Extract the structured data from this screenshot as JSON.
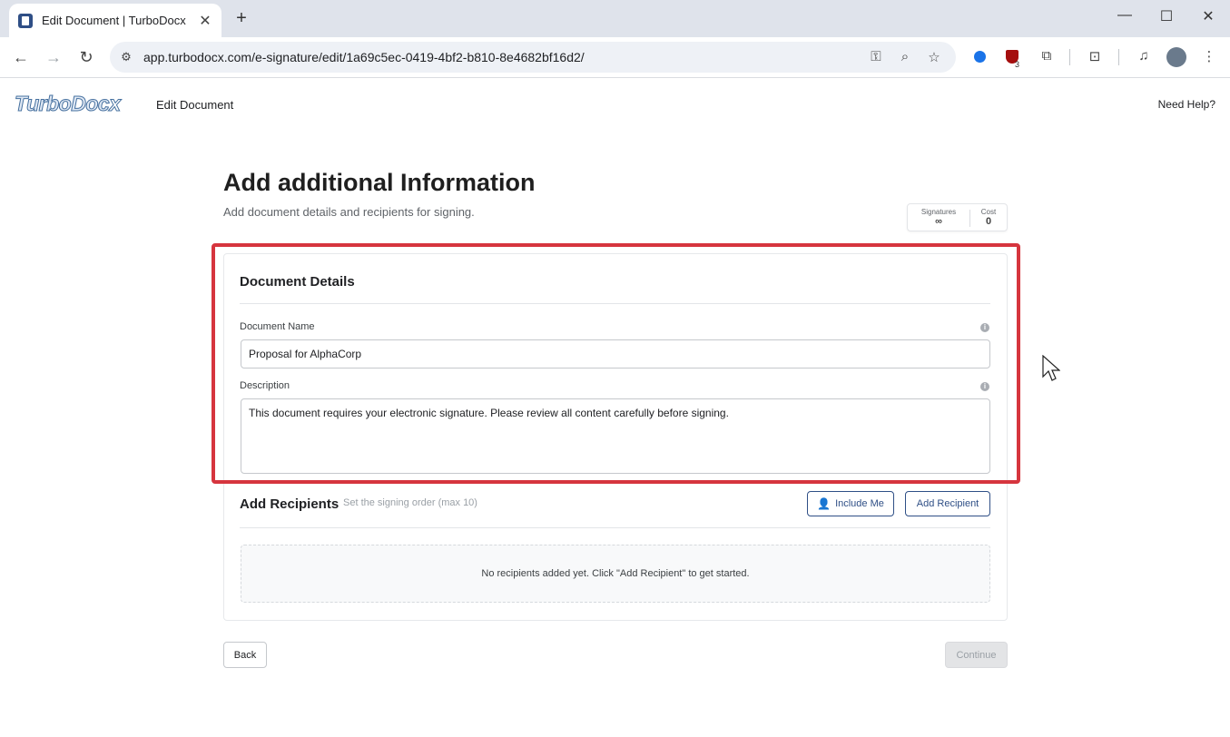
{
  "browser": {
    "tab_title": "Edit Document | TurboDocx",
    "url": "app.turbodocx.com/e-signature/edit/1a69c5ec-0419-4bf2-b810-8e4682bf16d2/",
    "extension_badge": "3"
  },
  "app": {
    "logo": "TurboDoc",
    "logo_x": "x",
    "header_title": "Edit Document",
    "help_link": "Need Help?"
  },
  "page": {
    "title": "Add additional Information",
    "subtitle": "Add document details and recipients for signing."
  },
  "stats": {
    "signatures_label": "Signatures",
    "signatures_value": "∞",
    "cost_label": "Cost",
    "cost_value": "0"
  },
  "document_details": {
    "title": "Document Details",
    "name_label": "Document Name",
    "name_value": "Proposal for AlphaCorp",
    "description_label": "Description",
    "description_value": "This document requires your electronic signature. Please review all content carefully before signing."
  },
  "recipients": {
    "title": "Add Recipients",
    "hint": "Set the signing order (max 10)",
    "include_me": "Include Me",
    "add_recipient": "Add Recipient",
    "empty_message": "No recipients added yet. Click \"Add Recipient\" to get started."
  },
  "footer": {
    "back": "Back",
    "continue": "Continue"
  },
  "colors": {
    "accent": "#2f4f86",
    "highlight": "#d6353e"
  }
}
